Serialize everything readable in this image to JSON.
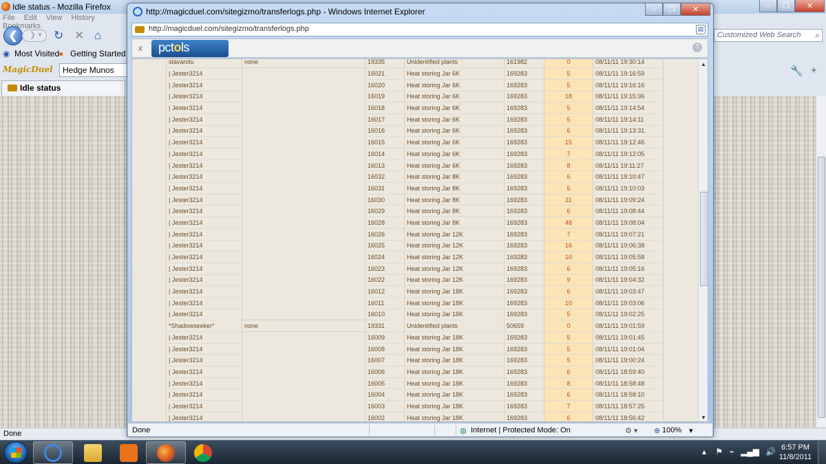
{
  "firefox": {
    "window_title": "Idle status - Mozilla Firefox",
    "menu": [
      "File",
      "Edit",
      "View",
      "History",
      "Bookmarks"
    ],
    "bookmarks": {
      "most_visited": "Most Visited",
      "getting_started": "Getting Started"
    },
    "magicduel_logo": "MagicDuel",
    "character_combo": "Hedge Munos",
    "tab_label": "Idle status",
    "search_placeholder": "Customized Web Search",
    "status": "Done"
  },
  "ie": {
    "window_title": "http://magicduel.com/sitegizmo/transferlogs.php - Windows Internet Explorer",
    "url": "http://magicduel.com/sitegizmo/transferlogs.php",
    "pctools": {
      "close": "x",
      "logo_a": "pct",
      "logo_b": "o",
      "logo_c": "ls",
      "help": "?"
    },
    "status": {
      "text": "Done",
      "zone": "Internet | Protected Mode: On",
      "zoom": "100%"
    }
  },
  "log_rows": [
    [
      "stavarolu",
      "none",
      "19335",
      "Unidentified plants",
      "161982",
      "0",
      "08/11/11 19:30:14"
    ],
    [
      "| Jester3214",
      "",
      "16021",
      "Heat storing Jar 6K",
      "169283",
      "5",
      "08/11/11 19:16:59"
    ],
    [
      "| Jester3214",
      "",
      "16020",
      "Heat storing Jar 6K",
      "169283",
      "5",
      "08/11/11 19:16:16"
    ],
    [
      "| Jester3214",
      "",
      "16019",
      "Heat storing Jar 6K",
      "169283",
      "18",
      "08/11/11 19:15:36"
    ],
    [
      "| Jester3214",
      "",
      "16018",
      "Heat storing Jar 6K",
      "169283",
      "5",
      "08/11/11 19:14:54"
    ],
    [
      "| Jester3214",
      "",
      "16017",
      "Heat storing Jar 6K",
      "169283",
      "5",
      "08/11/11 19:14:11"
    ],
    [
      "| Jester3214",
      "",
      "16016",
      "Heat storing Jar 6K",
      "169283",
      "6",
      "08/11/11 19:13:31"
    ],
    [
      "| Jester3214",
      "",
      "16015",
      "Heat storing Jar 6K",
      "169283",
      "15",
      "08/11/11 19:12:46"
    ],
    [
      "| Jester3214",
      "",
      "16014",
      "Heat storing Jar 6K",
      "169283",
      "7",
      "08/11/11 19:12:05"
    ],
    [
      "| Jester3214",
      "",
      "16013",
      "Heat storing Jar 6K",
      "169283",
      "8",
      "08/11/11 19:11:27"
    ],
    [
      "| Jester3214",
      "",
      "16032",
      "Heat storing Jar 8K",
      "169283",
      "6",
      "08/11/11 19:10:47"
    ],
    [
      "| Jester3214",
      "",
      "16031",
      "Heat storing Jar 8K",
      "169283",
      "5",
      "08/11/11 19:10:03"
    ],
    [
      "| Jester3214",
      "",
      "16030",
      "Heat storing Jar 8K",
      "169283",
      "31",
      "08/11/11 19:09:24"
    ],
    [
      "| Jester3214",
      "",
      "16029",
      "Heat storing Jar 8K",
      "169283",
      "6",
      "08/11/11 19:08:44"
    ],
    [
      "| Jester3214",
      "",
      "16028",
      "Heat storing Jar 8K",
      "169283",
      "48",
      "08/11/11 19:08:04"
    ],
    [
      "| Jester3214",
      "",
      "16026",
      "Heat storing Jar 12K",
      "169283",
      "7",
      "08/11/11 19:07:21"
    ],
    [
      "| Jester3214",
      "",
      "16025",
      "Heat storing Jar 12K",
      "169283",
      "16",
      "08/11/11 19:06:38"
    ],
    [
      "| Jester3214",
      "",
      "16024",
      "Heat storing Jar 12K",
      "169283",
      "10",
      "08/11/11 19:05:58"
    ],
    [
      "| Jester3214",
      "",
      "16023",
      "Heat storing Jar 12K",
      "169283",
      "6",
      "08/11/11 19:05:16"
    ],
    [
      "| Jester3214",
      "",
      "16022",
      "Heat storing Jar 12K",
      "169283",
      "9",
      "08/11/11 19:04:32"
    ],
    [
      "| Jester3214",
      "",
      "16012",
      "Heat storing Jar 18K",
      "169283",
      "6",
      "08/11/11 19:03:47"
    ],
    [
      "| Jester3214",
      "",
      "16011",
      "Heat storing Jar 18K",
      "169283",
      "10",
      "08/11/11 19:03:06"
    ],
    [
      "| Jester3214",
      "",
      "16010",
      "Heat storing Jar 18K",
      "169283",
      "5",
      "08/11/11 19:02:25"
    ],
    [
      "*Shadowseeker*",
      "none",
      "19331",
      "Unidentified plants",
      "50659",
      "0",
      "08/11/11 19:01:59"
    ],
    [
      "| Jester3214",
      "",
      "16009",
      "Heat storing Jar 18K",
      "169283",
      "5",
      "08/11/11 19:01:45"
    ],
    [
      "| Jester3214",
      "",
      "16008",
      "Heat storing Jar 18K",
      "169283",
      "5",
      "08/11/11 19:01:04"
    ],
    [
      "| Jester3214",
      "",
      "16007",
      "Heat storing Jar 18K",
      "169283",
      "5",
      "08/11/11 19:00:24"
    ],
    [
      "| Jester3214",
      "",
      "16006",
      "Heat storing Jar 18K",
      "169283",
      "6",
      "08/11/11 18:59:40"
    ],
    [
      "| Jester3214",
      "",
      "16005",
      "Heat storing Jar 18K",
      "169283",
      "8",
      "08/11/11 18:58:48"
    ],
    [
      "| Jester3214",
      "",
      "16004",
      "Heat storing Jar 18K",
      "169283",
      "6",
      "08/11/11 18:58:10"
    ],
    [
      "| Jester3214",
      "",
      "16003",
      "Heat storing Jar 18K",
      "169283",
      "7",
      "08/11/11 18:57:25"
    ],
    [
      "| Jester3214",
      "",
      "16002",
      "Heat storing Jar 18K",
      "169283",
      "6",
      "08/11/11 18:56:42"
    ]
  ],
  "taskbar": {
    "apps": [
      "start-orb",
      "internet-explorer",
      "windows-explorer",
      "media-player",
      "firefox",
      "chrome"
    ],
    "clock_time": "6:57 PM",
    "clock_date": "11/8/2011"
  },
  "colors": {
    "highlight_cell": "#fbe4b6",
    "table_text": "#6b4a27"
  }
}
